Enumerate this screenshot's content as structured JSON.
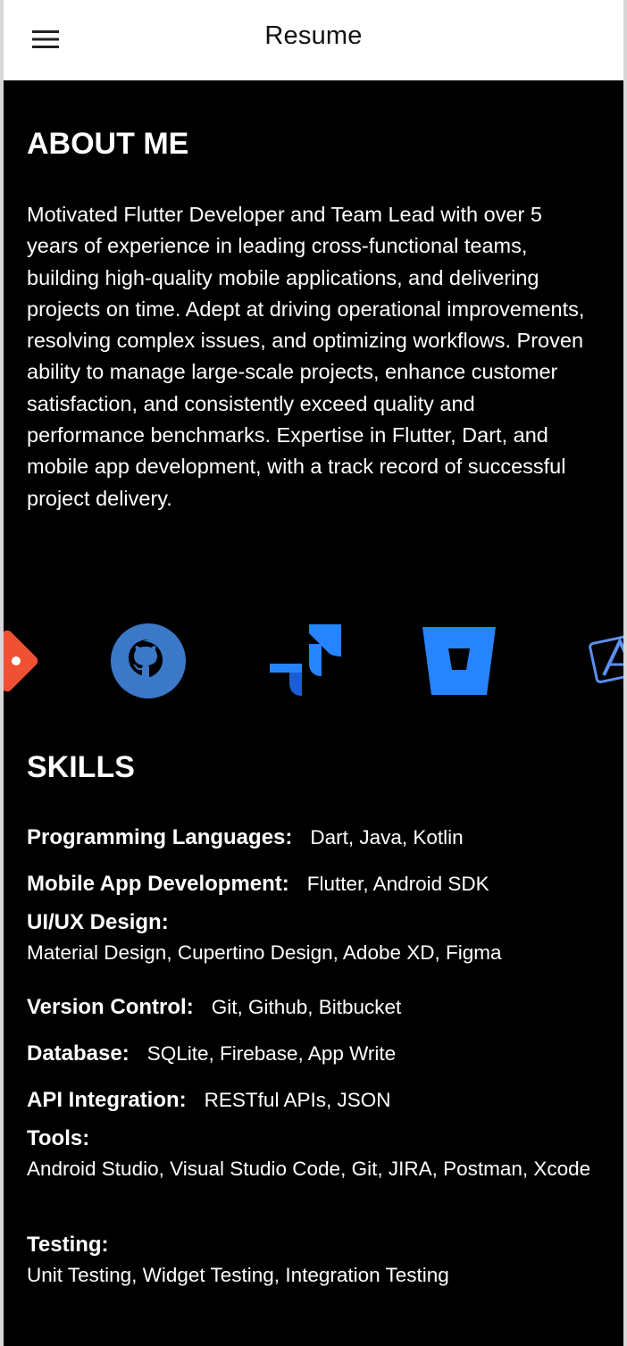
{
  "appbar": {
    "title": "Resume",
    "menu_icon": "menu-icon",
    "background": "#ffffff"
  },
  "about": {
    "heading": "ABOUT ME",
    "text": "Motivated Flutter Developer and Team Lead with over 5 years of experience in leading cross-functional teams, building high-quality mobile applications, and delivering projects on time. Adept at driving operational improvements, resolving complex issues, and optimizing workflows. Proven ability to manage large-scale projects, enhance customer satisfaction, and consistently exceed quality and performance benchmarks. Expertise in Flutter, Dart, and mobile app development, with a track record of successful project delivery."
  },
  "tools_carousel": {
    "logos": [
      "git-logo-icon",
      "github-logo-icon",
      "jira-logo-icon",
      "bitbucket-logo-icon",
      "xcode-logo-icon"
    ],
    "accent": "#2684ff"
  },
  "skills": {
    "heading": "SKILLS",
    "items": [
      {
        "label": "Programming Languages:",
        "value": "Dart, Java, Kotlin"
      },
      {
        "label": "Mobile App Development:",
        "value": "Flutter, Android SDK"
      },
      {
        "label": "UI/UX Design:",
        "value": "Material Design, Cupertino Design, Adobe XD, Figma"
      },
      {
        "label": "Version Control:",
        "value": "Git, Github, Bitbucket"
      },
      {
        "label": "Database:",
        "value": "SQLite, Firebase, App Write"
      },
      {
        "label": "API Integration:",
        "value": "RESTful APIs, JSON"
      },
      {
        "label": "Tools:",
        "value": "Android Studio, Visual Studio Code, Git, JIRA, Postman, Xcode"
      },
      {
        "label": "Testing:",
        "value": "Unit Testing, Widget Testing, Integration Testing"
      }
    ]
  },
  "colors": {
    "background": "#000000",
    "text": "#ffffff",
    "git_orange": "#f05033",
    "logo_blue": "#2684ff",
    "github_blue": "#3b78c7"
  }
}
